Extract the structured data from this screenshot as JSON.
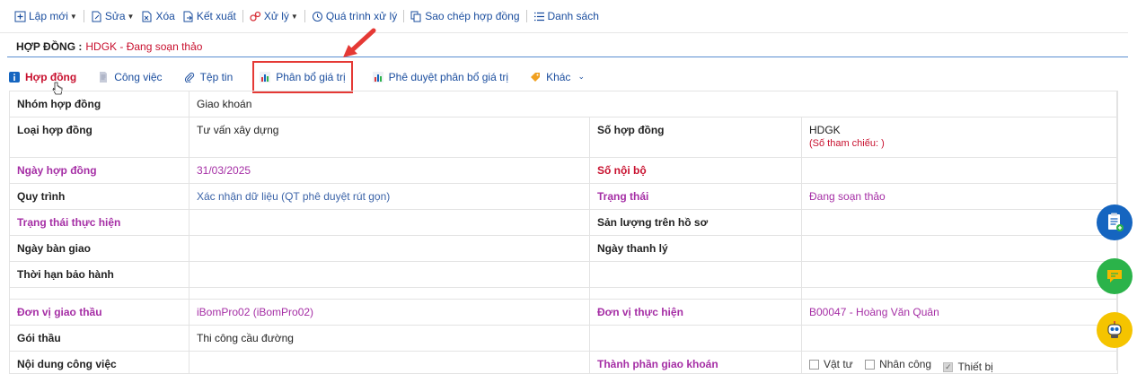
{
  "toolbar": {
    "new": "Lập mới",
    "edit": "Sửa",
    "delete": "Xóa",
    "export": "Kết xuất",
    "process": "Xử lý",
    "history": "Quá trình xử lý",
    "copy": "Sao chép hợp đồng",
    "list": "Danh sách"
  },
  "header": {
    "label": "HỢP ĐỒNG :",
    "value": "HDGK - Đang soạn thảo"
  },
  "tabs": [
    {
      "label": "Hợp đồng"
    },
    {
      "label": "Công việc"
    },
    {
      "label": "Tệp tin"
    },
    {
      "label": "Phân bổ giá trị"
    },
    {
      "label": "Phê duyệt phân bổ giá trị"
    },
    {
      "label": "Khác"
    }
  ],
  "fields": {
    "nhom_hop_dong": {
      "label": "Nhóm hợp đồng",
      "value": "Giao khoán"
    },
    "loai_hop_dong": {
      "label": "Loại hợp đồng",
      "value": "Tư vấn xây dựng"
    },
    "so_hop_dong": {
      "label": "Số hợp đồng",
      "value": "HDGK",
      "sub": "(Số tham chiếu: )"
    },
    "ngay_hop_dong": {
      "label": "Ngày hợp đồng",
      "value": "31/03/2025"
    },
    "so_noi_bo": {
      "label": "Số nội bộ",
      "value": ""
    },
    "quy_trinh": {
      "label": "Quy trình",
      "value": "Xác nhận dữ liệu (QT phê duyệt rút gọn)"
    },
    "trang_thai": {
      "label": "Trạng thái",
      "value": "Đang soạn thảo"
    },
    "trang_thai_thuc_hien": {
      "label": "Trạng thái thực hiện",
      "value": ""
    },
    "san_luong": {
      "label": "Sản lượng trên hồ sơ",
      "value": ""
    },
    "ngay_ban_giao": {
      "label": "Ngày bàn giao",
      "value": ""
    },
    "ngay_thanh_ly": {
      "label": "Ngày thanh lý",
      "value": ""
    },
    "thoi_han_bao_hanh": {
      "label": "Thời hạn bảo hành",
      "value": ""
    },
    "don_vi_giao_thau": {
      "label": "Đơn vị giao thầu",
      "value": "iBomPro02 (iBomPro02)"
    },
    "don_vi_thuc_hien": {
      "label": "Đơn vị thực hiện",
      "value": "B00047 - Hoàng Văn Quân"
    },
    "goi_thau": {
      "label": "Gói thầu",
      "value": "Thi công cầu đường"
    },
    "noi_dung_cong_viec": {
      "label": "Nội dung công việc",
      "value": ""
    },
    "thanh_phan_giao_khoan": {
      "label": "Thành phần giao khoán",
      "options": [
        {
          "label": "Vật tư",
          "checked": false
        },
        {
          "label": "Nhân công",
          "checked": false
        },
        {
          "label": "Thiết bị",
          "checked": true
        }
      ]
    }
  },
  "colors": {
    "accent_blue": "#1a4d9e",
    "title_red": "#c8102e",
    "purple": "#a52ea5",
    "fab_blue": "#1565c0",
    "fab_green": "#2bb34a",
    "fab_yellow": "#f5c400"
  },
  "icons": [
    "add-icon",
    "edit-icon",
    "delete-icon",
    "export-icon",
    "process-icon",
    "history-icon",
    "copy-icon",
    "list-icon",
    "info-icon",
    "document-icon",
    "paperclip-icon",
    "chart-icon",
    "tag-icon",
    "clipboard-icon",
    "chat-icon",
    "robot-icon"
  ]
}
